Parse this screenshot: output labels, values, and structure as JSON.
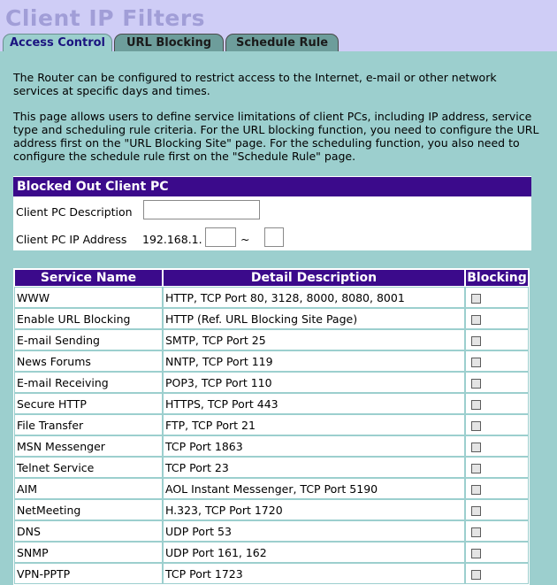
{
  "header": {
    "title": "Client IP Filters",
    "tabs": [
      {
        "label": "Access Control",
        "active": true
      },
      {
        "label": "URL Blocking",
        "active": false
      },
      {
        "label": "Schedule Rule",
        "active": false
      }
    ]
  },
  "intro": {
    "p1": "The Router can be configured to restrict access to the Internet, e-mail or other network services at specific days and times.",
    "p2": "This page allows users to define service limitations of client PCs, including IP address, service type and scheduling rule criteria. For the URL blocking function, you need to configure the URL address first on the \"URL Blocking Site\" page. For the scheduling function, you also need to configure the schedule rule first on the \"Schedule Rule\" page."
  },
  "client": {
    "section_title": "Blocked Out Client PC",
    "description_label": "Client PC Description",
    "description_value": "",
    "ip_label": "Client PC IP Address",
    "ip_prefix": "192.168.1.",
    "ip_start": "",
    "ip_separator": "~",
    "ip_end": ""
  },
  "services": {
    "headers": {
      "name": "Service Name",
      "detail": "Detail Description",
      "blocking": "Blocking"
    },
    "rows": [
      {
        "name": "WWW",
        "detail": "HTTP, TCP Port 80, 3128, 8000, 8080, 8001",
        "blocked": false
      },
      {
        "name": "Enable URL Blocking",
        "detail": "HTTP (Ref. URL Blocking Site Page)",
        "blocked": false
      },
      {
        "name": "E-mail Sending",
        "detail": "SMTP, TCP Port 25",
        "blocked": false
      },
      {
        "name": "News Forums",
        "detail": "NNTP, TCP Port 119",
        "blocked": false
      },
      {
        "name": "E-mail Receiving",
        "detail": "POP3, TCP Port 110",
        "blocked": false
      },
      {
        "name": "Secure HTTP",
        "detail": "HTTPS, TCP Port 443",
        "blocked": false
      },
      {
        "name": "File Transfer",
        "detail": "FTP, TCP Port 21",
        "blocked": false
      },
      {
        "name": "MSN Messenger",
        "detail": "TCP Port 1863",
        "blocked": false
      },
      {
        "name": "Telnet Service",
        "detail": "TCP Port 23",
        "blocked": false
      },
      {
        "name": "AIM",
        "detail": "AOL Instant Messenger, TCP Port 5190",
        "blocked": false
      },
      {
        "name": "NetMeeting",
        "detail": "H.323, TCP Port 1720",
        "blocked": false
      },
      {
        "name": "DNS",
        "detail": "UDP Port 53",
        "blocked": false
      },
      {
        "name": "SNMP",
        "detail": "UDP Port 161, 162",
        "blocked": false
      },
      {
        "name": "VPN-PPTP",
        "detail": "TCP Port 1723",
        "blocked": false
      }
    ]
  }
}
